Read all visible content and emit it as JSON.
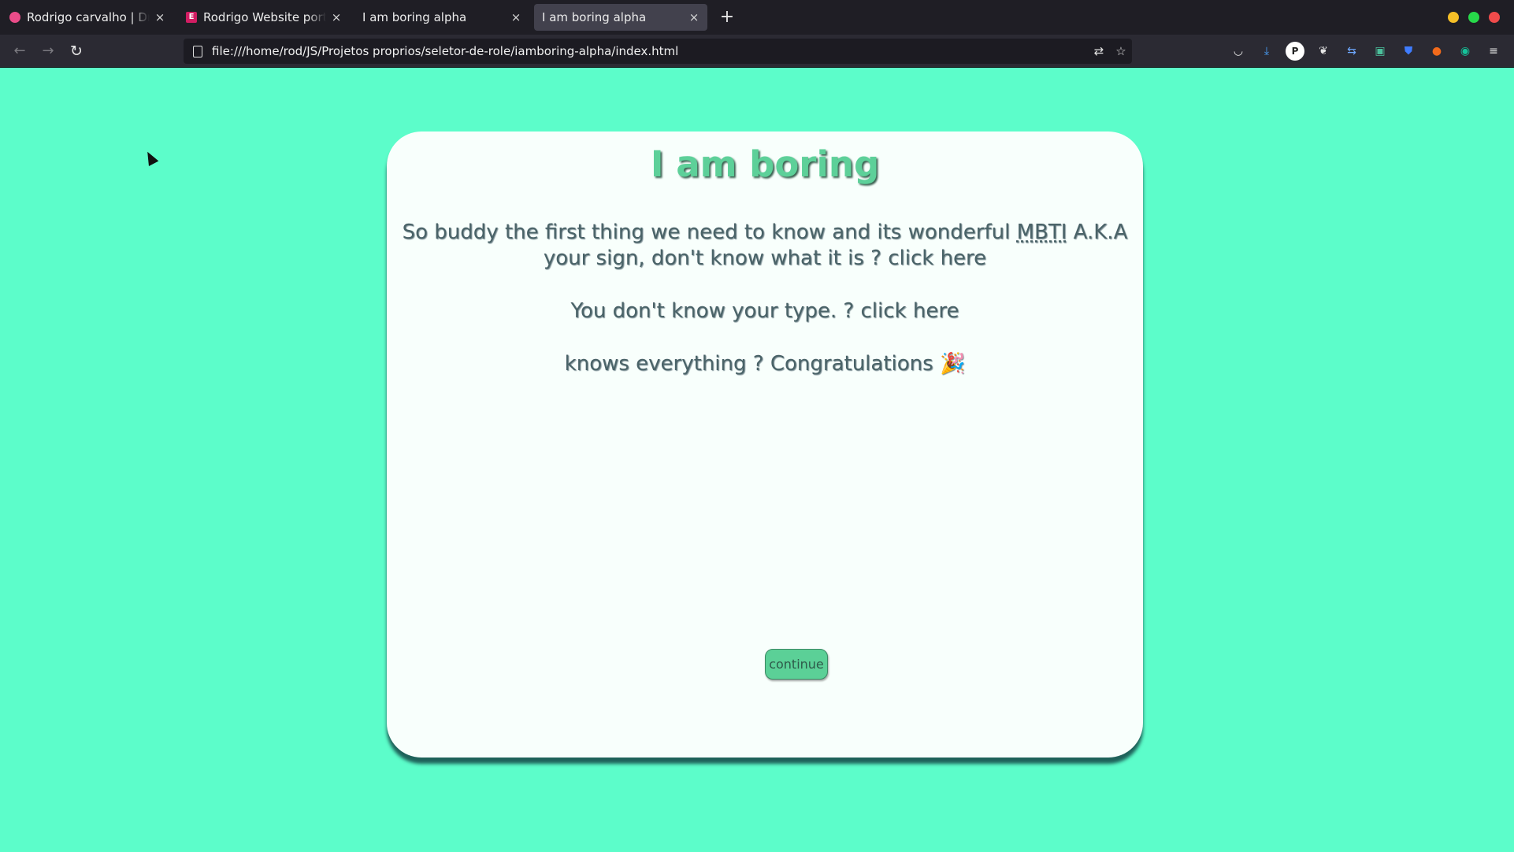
{
  "browser": {
    "tabs": [
      {
        "title": "Rodrigo carvalho | Dribbble",
        "icon": "dribbble-icon",
        "active": false
      },
      {
        "title": "Rodrigo Website portfolio",
        "icon": "e-icon",
        "active": false
      },
      {
        "title": "I am boring alpha",
        "icon": "",
        "active": false
      },
      {
        "title": "I am boring alpha",
        "icon": "",
        "active": true
      }
    ],
    "close_glyph": "×",
    "new_tab_glyph": "+",
    "url": "file:///home/rod/JS/Projetos proprios/seletor-de-role/iamboring-alpha/index.html",
    "window_colors": {
      "minimize": "#f5bf27",
      "maximize": "#27d94a",
      "close": "#ef4b4b"
    },
    "toolbar_icons": [
      "pocket-icon",
      "download-icon",
      "extension-p-icon",
      "extension-leaf-icon",
      "translate-icon",
      "save-icon",
      "bitwarden-icon",
      "duckduckgo-icon",
      "grammarly-icon",
      "menu-icon"
    ]
  },
  "page": {
    "heading": "I am boring",
    "para1_a": "So buddy the first thing we need to know and its wonderful ",
    "para1_abbr": "MBTI",
    "para1_b": " A.K.A your sign, don't know what it is ? click here",
    "para2": "You don't know your type. ? click here",
    "para3": "knows everything ? Congratulations 🎉",
    "continue_label": "continue",
    "colors": {
      "background": "#5cfdca",
      "card": "#f8fffc",
      "heading": "#5dd099",
      "button": "#5bd097"
    }
  }
}
